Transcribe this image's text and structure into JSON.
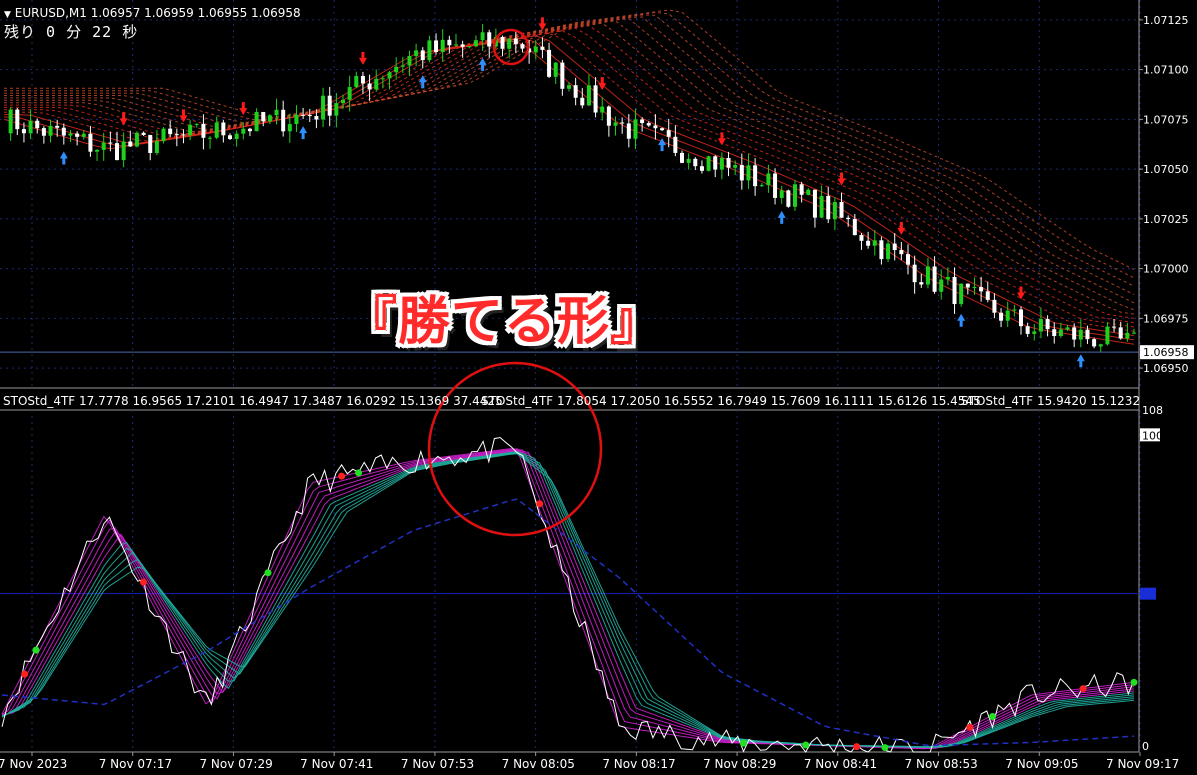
{
  "header": {
    "symbol_line": "EURUSD,M1  1.06957 1.06959 1.06955 1.06958",
    "timer": "残り 0 分 22 秒"
  },
  "overlay": {
    "title": "『勝てる形』"
  },
  "indicator_header": {
    "segments": [
      "STOStd_4TF 17.7778 16.9565 17.2101 16.4947 17.3487 16.0292 15.1369 37.4425",
      "STOStd_4TF 17.8054 17.2050 16.5552 16.7949 15.7609 16.1111 15.6126 15.4545",
      "STOStd_4TF 15.9420 15.1232"
    ]
  },
  "colors": {
    "background": "#000000",
    "grid": "#1c2a6e",
    "bull_candle": "#1fd11f",
    "bear_candle": "#ffffff",
    "down_arrow": "#ff1a1a",
    "up_arrow": "#2f8fff",
    "ma_up": "#4aa0ff",
    "ma_down": "#e02a1a",
    "circle": "#e01010",
    "stoch_main": "#ffffff",
    "stoch_fan_a": "#d020d0",
    "stoch_fan_b": "#20b0a0",
    "stoch_slow": "#2030c0",
    "level_line": "#1020c0"
  },
  "chart_data": [
    {
      "type": "line",
      "title": "EURUSD,M1",
      "x": [
        "7 Nov 2023",
        "7 Nov 07:17",
        "7 Nov 07:29",
        "7 Nov 07:41",
        "7 Nov 07:53",
        "7 Nov 08:05",
        "7 Nov 08:17",
        "7 Nov 08:29",
        "7 Nov 08:41",
        "7 Nov 08:53",
        "7 Nov 09:05",
        "7 Nov 09:17"
      ],
      "ylim": [
        1.0694,
        1.07135
      ],
      "y_ticks": [
        "1.07125",
        "1.07100",
        "1.07075",
        "1.07050",
        "1.07025",
        "1.07000",
        "1.06975",
        "1.06950"
      ],
      "current_price": "1.06958",
      "series": [
        {
          "values": [
            1.07075,
            1.0706,
            1.07068,
            1.07078,
            1.07108,
            1.07115,
            1.07072,
            1.07052,
            1.0703,
            1.06995,
            1.0697,
            1.06962
          ]
        }
      ]
    },
    {
      "type": "line",
      "ylim": [
        0,
        108
      ],
      "y_ticks": [
        "108",
        "100",
        "0"
      ],
      "level": 50,
      "series": [
        {
          "values": [
            12,
            75,
            14,
            85,
            92,
            96,
            8,
            3,
            2,
            1,
            18,
            22
          ]
        },
        {
          "values": [
            10,
            50,
            30,
            55,
            88,
            94,
            40,
            5,
            2,
            2,
            10,
            12
          ]
        },
        {
          "values": [
            18,
            15,
            32,
            52,
            70,
            80,
            55,
            25,
            8,
            2,
            3,
            5
          ]
        }
      ]
    }
  ]
}
